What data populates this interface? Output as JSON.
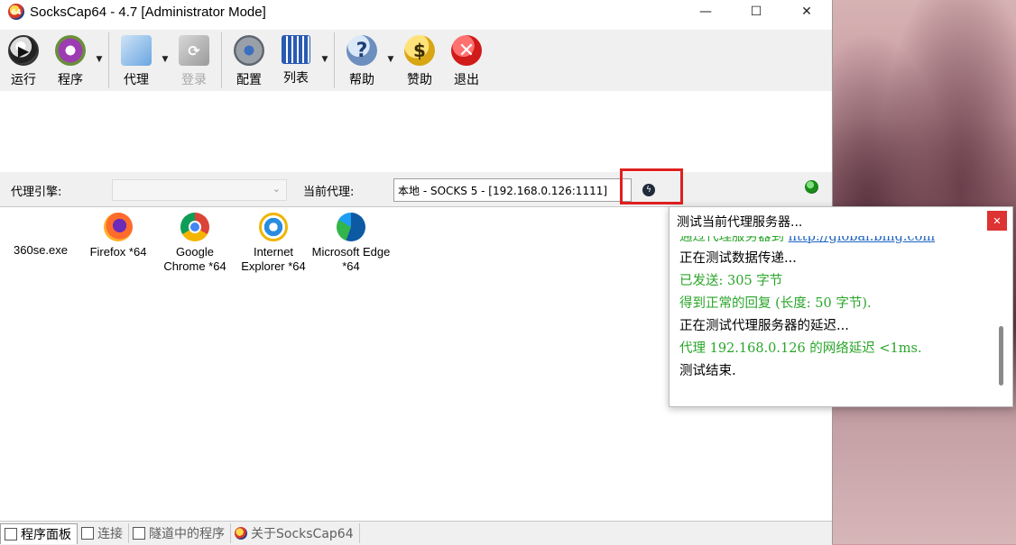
{
  "window": {
    "title": "SocksCap64 - 4.7 [Administrator Mode]",
    "app_icon_text": "64"
  },
  "titlebar_controls": {
    "minimize": "—",
    "maximize": "☐",
    "close": "✕"
  },
  "toolbar": {
    "run": "运行",
    "program": "程序",
    "proxy": "代理",
    "login": "登录",
    "config": "配置",
    "list": "列表",
    "help": "帮助",
    "donate": "赞助",
    "exit": "退出",
    "dropdown_glyph": "▼"
  },
  "proxy_bar": {
    "engine_label": "代理引擎:",
    "engine_value": "",
    "current_label": "当前代理:",
    "current_value": "本地 - SOCKS 5 - [192.168.0.126:1111]"
  },
  "programs": [
    {
      "label": "360se.exe",
      "icon": "360se-icon"
    },
    {
      "label": "Firefox *64",
      "icon": "firefox-icon"
    },
    {
      "label": "Google Chrome *64",
      "icon": "chrome-icon"
    },
    {
      "label": "Internet Explorer *64",
      "icon": "ie-icon"
    },
    {
      "label": "Microsoft Edge *64",
      "icon": "edge-icon"
    }
  ],
  "tabs": [
    {
      "label": "程序面板",
      "active": true
    },
    {
      "label": "连接",
      "active": false
    },
    {
      "label": "隧道中的程序",
      "active": false
    },
    {
      "label": "关于SocksCap64",
      "active": false
    }
  ],
  "popup": {
    "title": "测试当前代理服务器...",
    "partial_line_prefix": "通过代理服务器到 ",
    "partial_line_link": "http://global.bing.com",
    "lines": [
      {
        "text": "正在测试数据传递...",
        "color": "#000000"
      },
      {
        "text": "已发送: 305 字节",
        "color": "#2aa52a"
      },
      {
        "text": "得到正常的回复 (长度: 50 字节).",
        "color": "#2aa52a"
      },
      {
        "text": "正在测试代理服务器的延迟...",
        "color": "#000000"
      },
      {
        "text": "代理 192.168.0.126 的网络延迟 <1ms.",
        "color": "#2aa52a"
      },
      {
        "text": "测试结束.",
        "color": "#000000"
      }
    ],
    "close_glyph": "✕"
  },
  "colors": {
    "highlight_border": "#e02020",
    "success_text": "#2aa52a",
    "status_ok": "#1a8a1a"
  }
}
